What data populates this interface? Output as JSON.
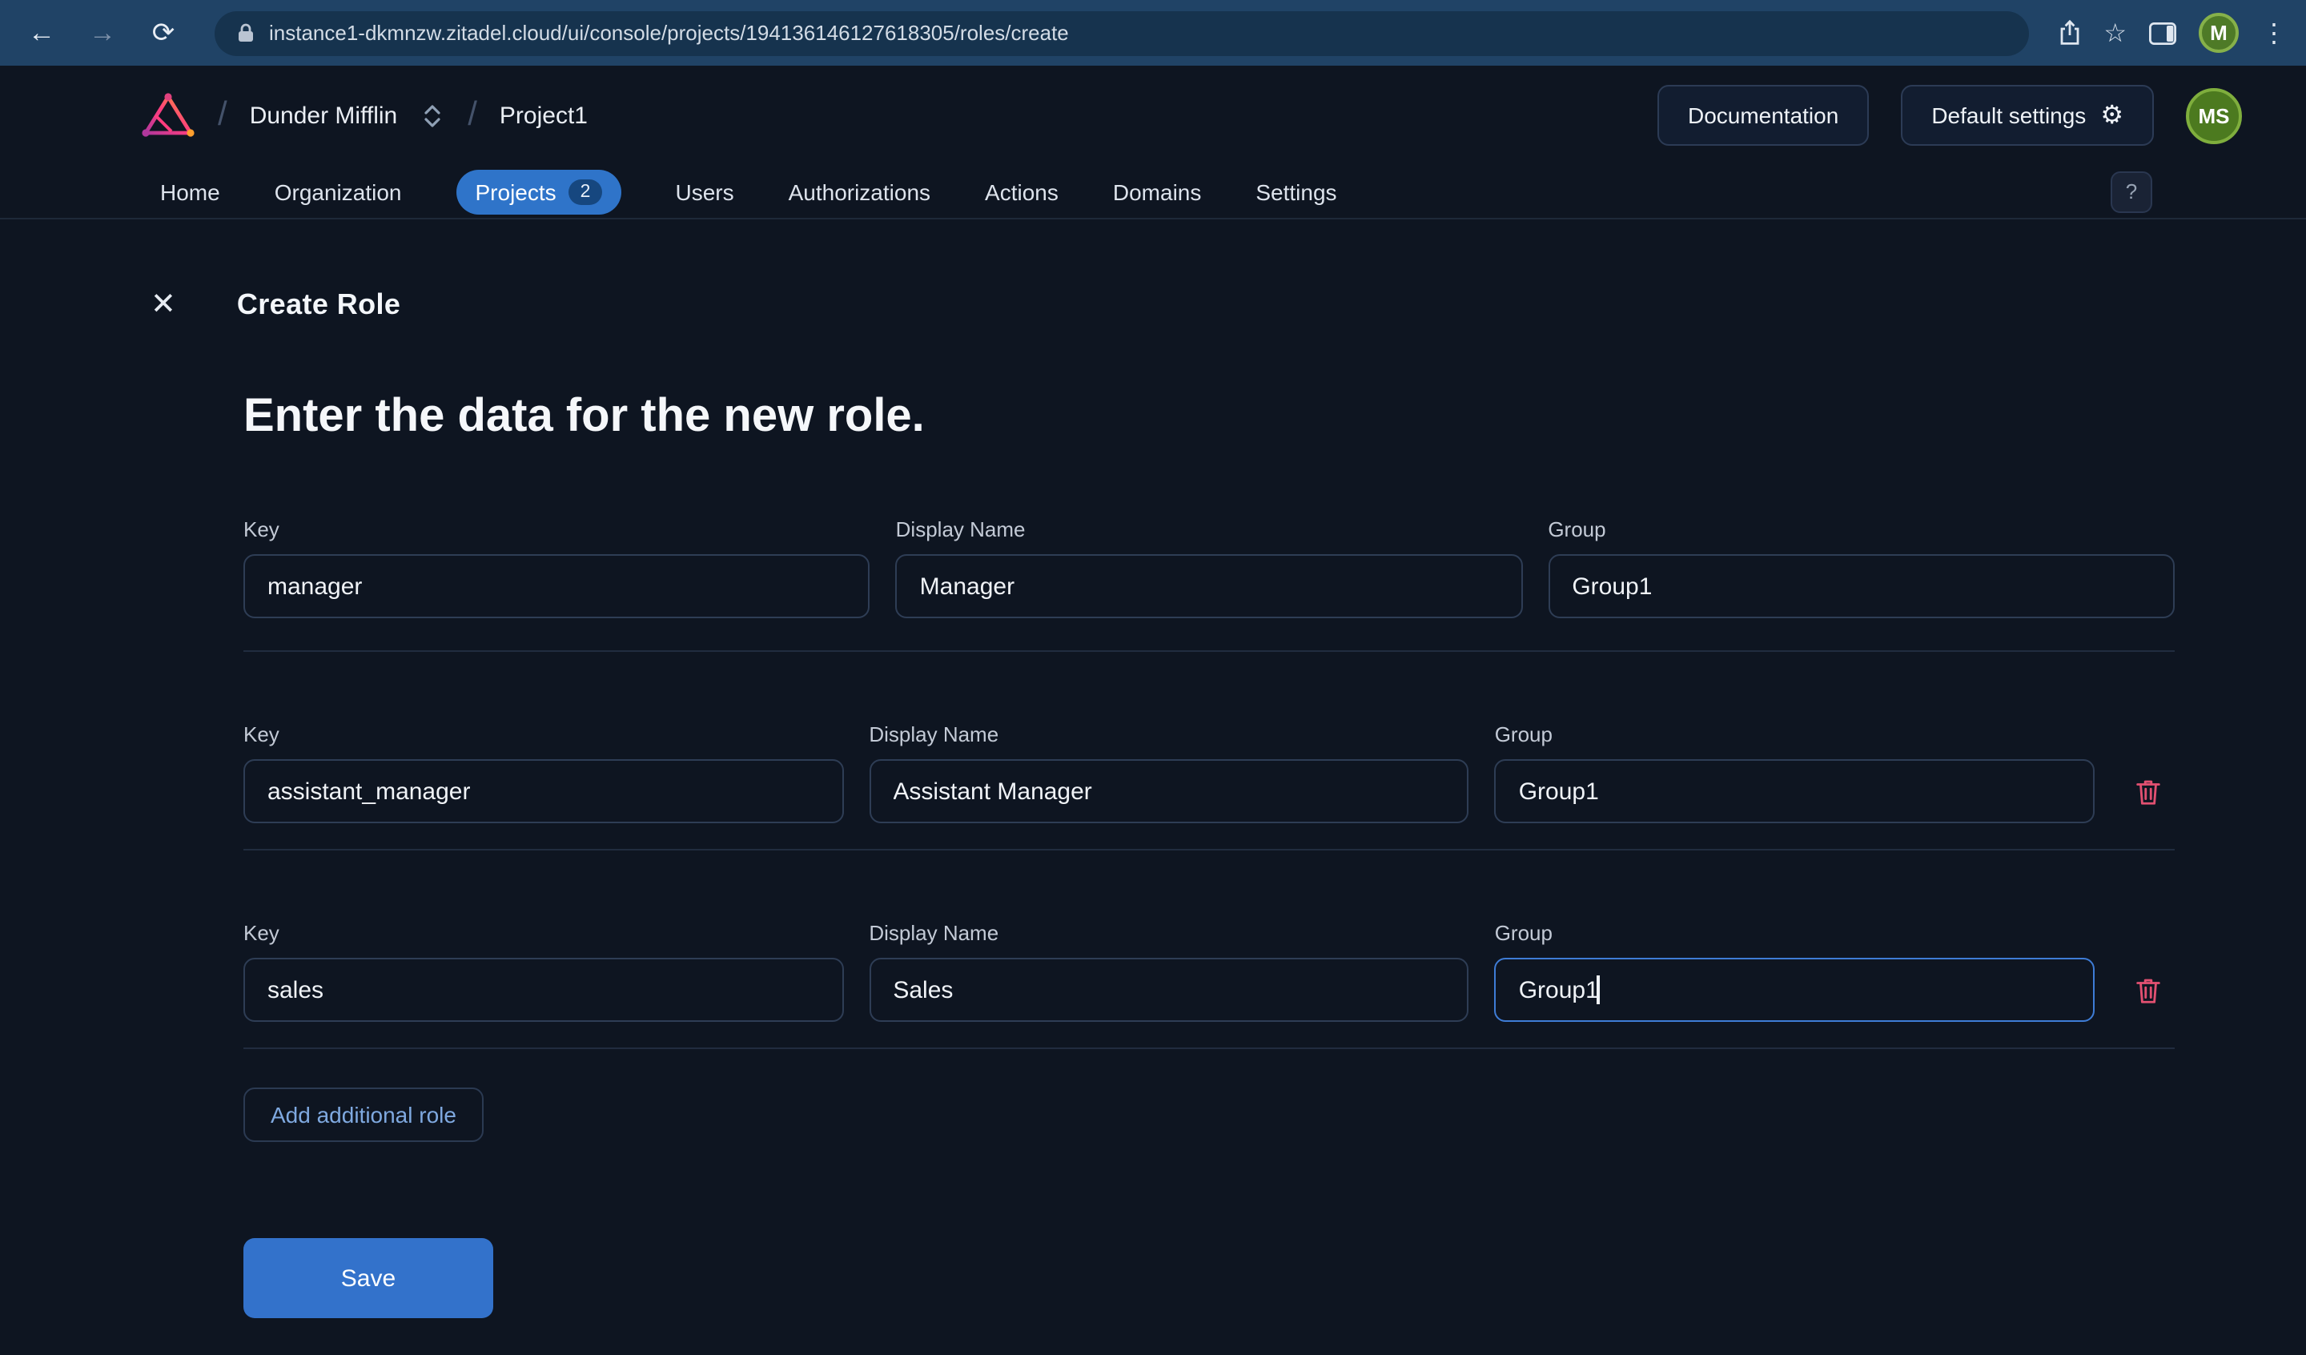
{
  "browser": {
    "url": "instance1-dkmnzw.zitadel.cloud/ui/console/projects/194136146127618305/roles/create",
    "profile_initial": "M"
  },
  "icons": {
    "back": "←",
    "forward": "→",
    "reload": "⟳",
    "star": "☆",
    "menu": "⋮",
    "close": "✕",
    "question": "?",
    "gear": "⚙",
    "slash": "/"
  },
  "header": {
    "org": "Dunder Mifflin",
    "project": "Project1",
    "documentation": "Documentation",
    "default_settings": "Default settings",
    "avatar": "MS"
  },
  "nav": {
    "items": [
      {
        "label": "Home"
      },
      {
        "label": "Organization"
      },
      {
        "label": "Projects",
        "badge": "2",
        "active": true
      },
      {
        "label": "Users"
      },
      {
        "label": "Authorizations"
      },
      {
        "label": "Actions"
      },
      {
        "label": "Domains"
      },
      {
        "label": "Settings"
      }
    ]
  },
  "page": {
    "title": "Create Role",
    "heading": "Enter the data for the new role.",
    "labels": {
      "key": "Key",
      "display_name": "Display Name",
      "group": "Group"
    },
    "rows": [
      {
        "key": "manager",
        "display_name": "Manager",
        "group": "Group1"
      },
      {
        "key": "assistant_manager",
        "display_name": "Assistant Manager",
        "group": "Group1"
      },
      {
        "key": "sales",
        "display_name": "Sales",
        "group": "Group1"
      }
    ],
    "add_role": "Add additional role",
    "save": "Save"
  },
  "colors": {
    "chrome": "#204366",
    "background": "#0e1521",
    "accent": "#2f74c9",
    "save_button": "#3372cb",
    "danger": "#e25071",
    "link": "#7fa9e0"
  }
}
